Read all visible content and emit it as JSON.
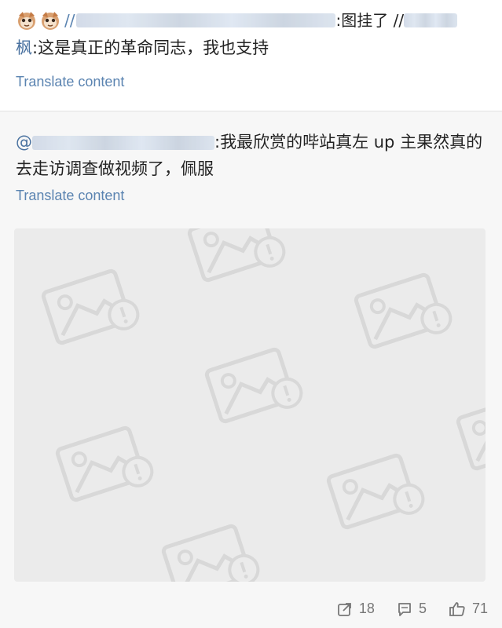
{
  "post": {
    "forward_prefix": "//",
    "hidden_user_1": "",
    "text_1": ":图挂了 //",
    "hidden_user_2": "",
    "text_2_user": "枫",
    "text_2": ":这是真正的革命同志，我也支持",
    "translate_label": "Translate content"
  },
  "repost": {
    "at_prefix": "@",
    "content": ":我最欣赏的哔站真左 up 主果然真的去走访调查做视频了，佩服",
    "translate_label": "Translate content"
  },
  "icons": {
    "cat": "cat-emoji-icon",
    "share": "share-icon",
    "comment": "comment-icon",
    "like": "thumb-up-icon",
    "broken_image": "broken-image-icon"
  },
  "footer": {
    "shares": "18",
    "comments": "5",
    "likes": "71"
  },
  "colors": {
    "link": "#5b84b1",
    "muted": "#777777",
    "panel": "#f7f7f7",
    "image_bg": "#ebebeb"
  }
}
